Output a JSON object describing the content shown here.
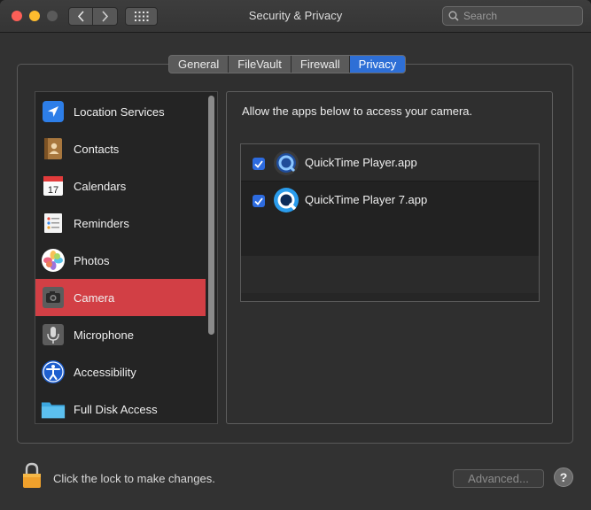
{
  "window": {
    "title": "Security & Privacy"
  },
  "search": {
    "placeholder": "Search"
  },
  "tabs": [
    {
      "label": "General",
      "active": false
    },
    {
      "label": "FileVault",
      "active": false
    },
    {
      "label": "Firewall",
      "active": false
    },
    {
      "label": "Privacy",
      "active": true
    }
  ],
  "sidebar": {
    "items": [
      {
        "label": "Location Services",
        "icon": "location-arrow-icon"
      },
      {
        "label": "Contacts",
        "icon": "contacts-book-icon"
      },
      {
        "label": "Calendars",
        "icon": "calendar-icon",
        "day": "17"
      },
      {
        "label": "Reminders",
        "icon": "reminders-list-icon"
      },
      {
        "label": "Photos",
        "icon": "photos-pinwheel-icon"
      },
      {
        "label": "Camera",
        "icon": "camera-icon",
        "selected": true
      },
      {
        "label": "Microphone",
        "icon": "microphone-icon"
      },
      {
        "label": "Accessibility",
        "icon": "accessibility-icon"
      },
      {
        "label": "Full Disk Access",
        "icon": "folder-icon"
      }
    ]
  },
  "main": {
    "description": "Allow the apps below to access your camera.",
    "apps": [
      {
        "name": "QuickTime Player.app",
        "checked": true,
        "icon": "quicktime-player-icon"
      },
      {
        "name": "QuickTime Player 7.app",
        "checked": true,
        "icon": "quicktime-player-7-icon"
      }
    ]
  },
  "footer": {
    "lock_text": "Click the lock to make changes.",
    "advanced_label": "Advanced...",
    "help_label": "?"
  },
  "colors": {
    "selected_row": "#d23f45",
    "accent": "#2e6fd6"
  }
}
